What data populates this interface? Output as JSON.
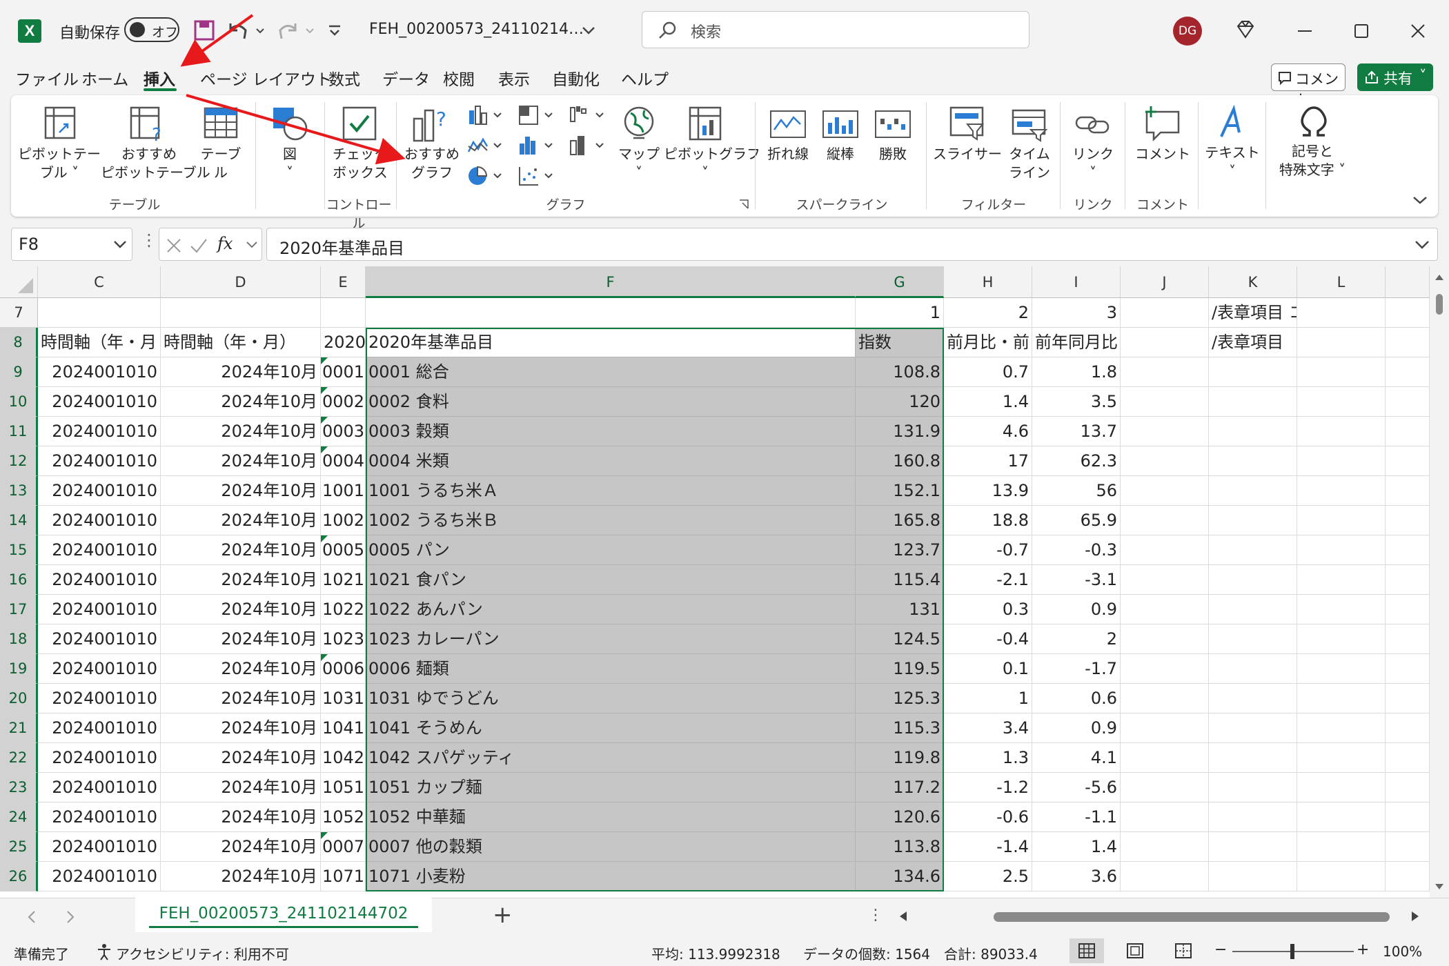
{
  "titlebar": {
    "app_icon": "X",
    "autosave_label": "自動保存",
    "autosave_state": "オフ",
    "filename": "FEH_00200573_24110214…",
    "search_placeholder": "検索",
    "user_initials": "DG"
  },
  "menu": {
    "items": [
      "ファイル",
      "ホーム",
      "挿入",
      "ページ レイアウト",
      "数式",
      "データ",
      "校閲",
      "表示",
      "自動化",
      "ヘルプ"
    ],
    "active": "挿入",
    "comment_label": "コメント",
    "share_label": "共有"
  },
  "ribbon": {
    "buttons": {
      "pivot_table": "ピボットテー\nブル ˅",
      "recommended_pivot": "おすすめ\nピボットテーブル",
      "table": "テーブル",
      "illustrations": "図\n˅",
      "checkbox": "チェック\nボックス",
      "recommended_charts": "おすすめ\nグラフ",
      "maps": "マップ\n˅",
      "pivot_chart": "ピボットグラフ\n˅",
      "line": "折れ線",
      "column": "縦棒",
      "winloss": "勝敗",
      "slicer": "スライサー",
      "timeline": "タイム\nライン",
      "link": "リンク\n˅",
      "comment": "コメント",
      "text": "テキスト\n˅",
      "symbols": "記号と\n特殊文字 ˅"
    },
    "groups": {
      "tables": "テーブル",
      "controls": "コントロール",
      "charts": "グラフ",
      "sparklines": "スパークライン",
      "filters": "フィルター",
      "links": "リンク",
      "comments": "コメント"
    }
  },
  "formula_bar": {
    "name_box": "F8",
    "fx": "fx",
    "formula": "2020年基準品目"
  },
  "sheet": {
    "columns": [
      "C",
      "D",
      "E",
      "F",
      "G",
      "H",
      "I",
      "J",
      "K",
      "L"
    ],
    "rows": [
      {
        "n": "7",
        "C": "",
        "D": "",
        "E": "",
        "F": "",
        "G": "1",
        "H": "2",
        "I": "3",
        "J": "",
        "K": "/表章項目 コード",
        "L": ""
      },
      {
        "n": "8",
        "C": "時間軸（年・月",
        "D": "時間軸（年・月）",
        "E": "2020",
        "F": "2020年基準品目",
        "G": "指数",
        "H": "前月比・前",
        "I": "前年同月比【%】",
        "J": "",
        "K": "/表章項目",
        "L": ""
      },
      {
        "n": "9",
        "C": "2024001010",
        "D": "2024年10月",
        "E": "0001",
        "F": "0001 総合",
        "G": "108.8",
        "H": "0.7",
        "I": "1.8"
      },
      {
        "n": "10",
        "C": "2024001010",
        "D": "2024年10月",
        "E": "0002",
        "F": "0002 食料",
        "G": "120",
        "H": "1.4",
        "I": "3.5"
      },
      {
        "n": "11",
        "C": "2024001010",
        "D": "2024年10月",
        "E": "0003",
        "F": "0003 穀類",
        "G": "131.9",
        "H": "4.6",
        "I": "13.7"
      },
      {
        "n": "12",
        "C": "2024001010",
        "D": "2024年10月",
        "E": "0004",
        "F": "0004 米類",
        "G": "160.8",
        "H": "17",
        "I": "62.3"
      },
      {
        "n": "13",
        "C": "2024001010",
        "D": "2024年10月",
        "E": "1001",
        "F": "1001 うるち米Ａ",
        "G": "152.1",
        "H": "13.9",
        "I": "56"
      },
      {
        "n": "14",
        "C": "2024001010",
        "D": "2024年10月",
        "E": "1002",
        "F": "1002 うるち米Ｂ",
        "G": "165.8",
        "H": "18.8",
        "I": "65.9"
      },
      {
        "n": "15",
        "C": "2024001010",
        "D": "2024年10月",
        "E": "0005",
        "F": "0005 パン",
        "G": "123.7",
        "H": "-0.7",
        "I": "-0.3"
      },
      {
        "n": "16",
        "C": "2024001010",
        "D": "2024年10月",
        "E": "1021",
        "F": "1021 食パン",
        "G": "115.4",
        "H": "-2.1",
        "I": "-3.1"
      },
      {
        "n": "17",
        "C": "2024001010",
        "D": "2024年10月",
        "E": "1022",
        "F": "1022 あんパン",
        "G": "131",
        "H": "0.3",
        "I": "0.9"
      },
      {
        "n": "18",
        "C": "2024001010",
        "D": "2024年10月",
        "E": "1023",
        "F": "1023 カレーパン",
        "G": "124.5",
        "H": "-0.4",
        "I": "2"
      },
      {
        "n": "19",
        "C": "2024001010",
        "D": "2024年10月",
        "E": "0006",
        "F": "0006 麺類",
        "G": "119.5",
        "H": "0.1",
        "I": "-1.7"
      },
      {
        "n": "20",
        "C": "2024001010",
        "D": "2024年10月",
        "E": "1031",
        "F": "1031 ゆでうどん",
        "G": "125.3",
        "H": "1",
        "I": "0.6"
      },
      {
        "n": "21",
        "C": "2024001010",
        "D": "2024年10月",
        "E": "1041",
        "F": "1041 そうめん",
        "G": "115.3",
        "H": "3.4",
        "I": "0.9"
      },
      {
        "n": "22",
        "C": "2024001010",
        "D": "2024年10月",
        "E": "1042",
        "F": "1042 スパゲッティ",
        "G": "119.8",
        "H": "1.3",
        "I": "4.1"
      },
      {
        "n": "23",
        "C": "2024001010",
        "D": "2024年10月",
        "E": "1051",
        "F": "1051 カップ麺",
        "G": "117.2",
        "H": "-1.2",
        "I": "-5.6"
      },
      {
        "n": "24",
        "C": "2024001010",
        "D": "2024年10月",
        "E": "1052",
        "F": "1052 中華麺",
        "G": "120.6",
        "H": "-0.6",
        "I": "-1.1"
      },
      {
        "n": "25",
        "C": "2024001010",
        "D": "2024年10月",
        "E": "0007",
        "F": "0007 他の穀類",
        "G": "113.8",
        "H": "-1.4",
        "I": "1.4"
      },
      {
        "n": "26",
        "C": "2024001010",
        "D": "2024年10月",
        "E": "1071",
        "F": "1071 小麦粉",
        "G": "134.6",
        "H": "2.5",
        "I": "3.6"
      }
    ]
  },
  "tabs": {
    "sheet_name": "FEH_00200573_241102144702",
    "add": "+"
  },
  "status": {
    "ready": "準備完了",
    "accessibility": "アクセシビリティ: 利用不可",
    "average": "平均: 113.9992318",
    "count": "データの個数: 1564",
    "sum": "合計: 89033.4",
    "zoom": "100%"
  },
  "colors": {
    "excel_green": "#107c41",
    "selection_gray": "#c6c6c6",
    "annotation_red": "#e8191b"
  }
}
